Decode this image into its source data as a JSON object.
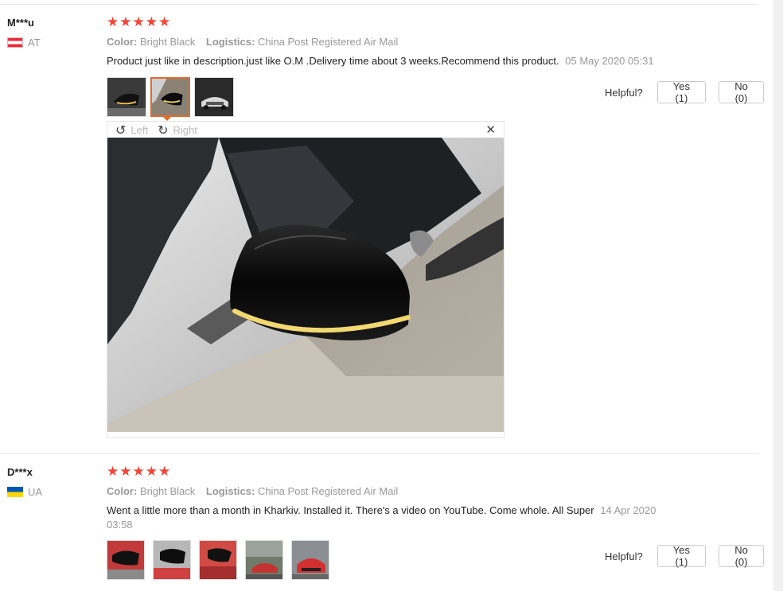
{
  "reviews": [
    {
      "user": "M***u",
      "country": "AT",
      "rating": 5,
      "color_key": "Color:",
      "color_val": "Bright Black",
      "logistics_key": "Logistics:",
      "logistics_val": "China Post Registered Air Mail",
      "text": "Product just like in description.just like O.M .Delivery time about 3 weeks.Recommend this product.",
      "date": "05 May 2020 05:31",
      "helpful_label": "Helpful?",
      "yes_label": "Yes (1)",
      "no_label": "No (0)",
      "viewer": {
        "left_label": "Left",
        "right_label": "Right"
      }
    },
    {
      "user": "D***x",
      "country": "UA",
      "rating": 5,
      "color_key": "Color:",
      "color_val": "Bright Black",
      "logistics_key": "Logistics:",
      "logistics_val": "China Post Registered Air Mail",
      "text": "Went a little more than a month in Kharkiv. Installed it. There's a video on YouTube. Come whole. All Super",
      "date": "14 Apr 2020 03:58",
      "helpful_label": "Helpful?",
      "yes_label": "Yes (1)",
      "no_label": "No (0)"
    }
  ],
  "icons": {
    "star": "star-icon",
    "rotate_left": "rotate-left-icon",
    "rotate_right": "rotate-right-icon",
    "close": "close-icon"
  },
  "colors": {
    "star": "#f44336",
    "active_thumb": "#e06b2c",
    "muted": "#999999"
  }
}
